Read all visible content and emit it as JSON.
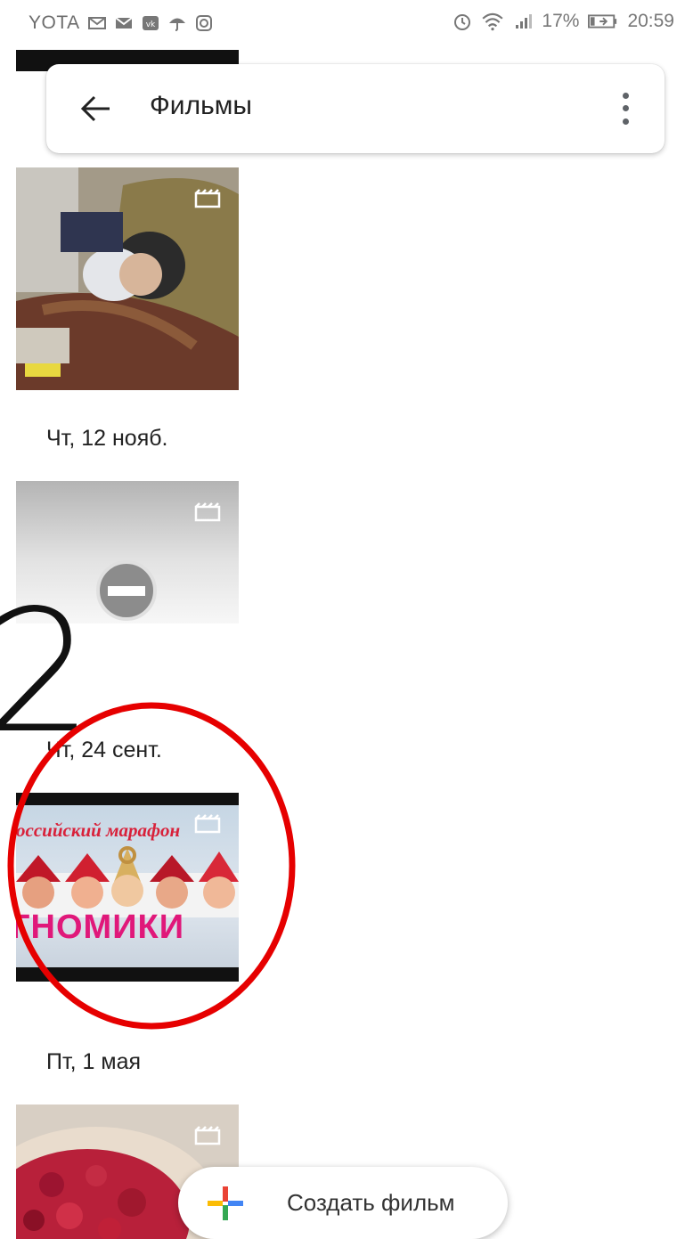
{
  "status_bar": {
    "carrier": "YOTA",
    "battery_percent": "17%",
    "time": "20:59"
  },
  "header": {
    "title": "Фильмы"
  },
  "movies": [
    {
      "date": "Чт, 12 нояб."
    },
    {
      "date": "Чт, 24 сент."
    },
    {
      "date": "Пт, 1 мая",
      "thumbnail_text_top": "оссийский марафон",
      "thumbnail_text_main": "ГНОМИКИ"
    },
    {
      "date": ""
    }
  ],
  "annotation": {
    "number": "2",
    "ellipse_color": "#e60000"
  },
  "fab": {
    "label": "Создать фильм"
  },
  "colors": {
    "text_primary": "#222222",
    "icon_grey": "#5f6368",
    "annotation_red": "#e60000"
  }
}
